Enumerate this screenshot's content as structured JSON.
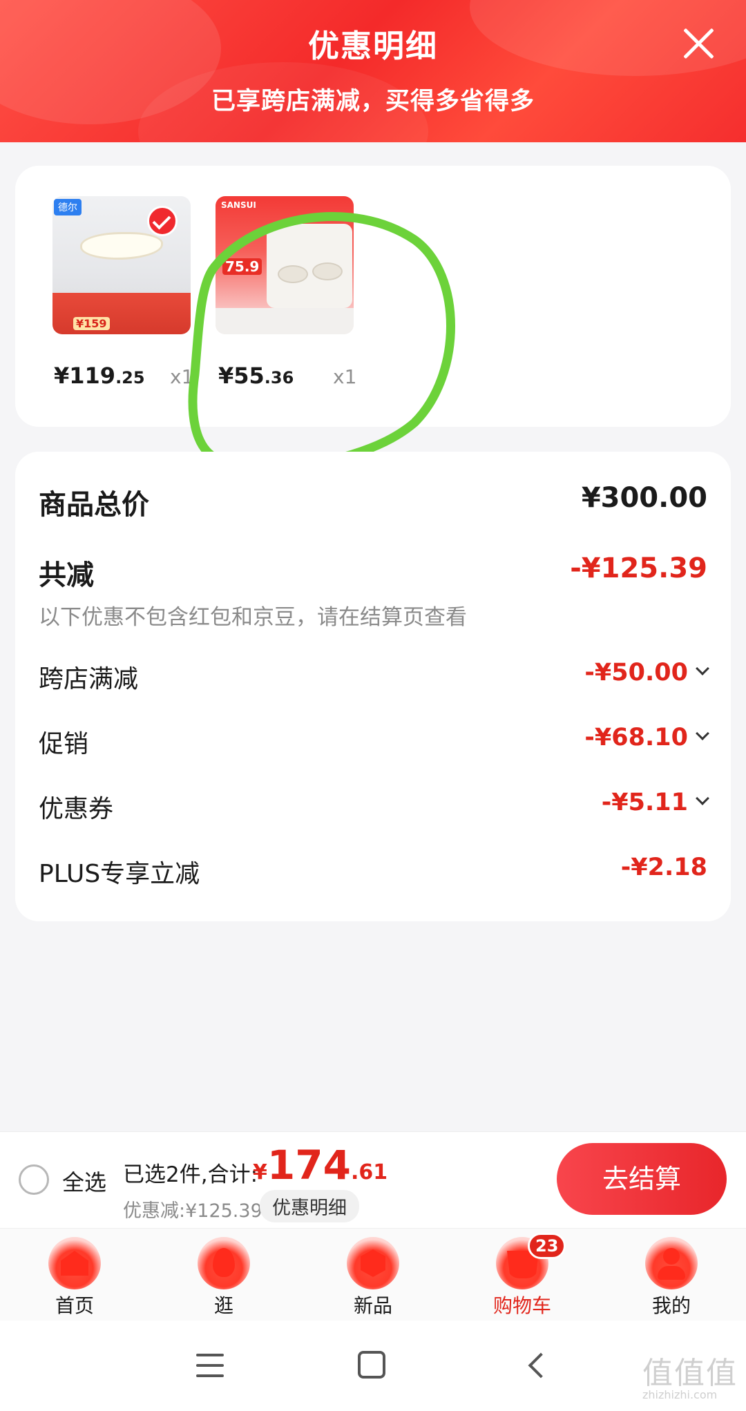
{
  "header": {
    "title": "优惠明细",
    "subtitle": "已享跨店满减，买得多省得多"
  },
  "products": [
    {
      "price_int": "¥119",
      "price_dec": ".25",
      "qty": "x1",
      "image_badge": "德尔",
      "image_price": "¥159"
    },
    {
      "price_int": "¥55",
      "price_dec": ".36",
      "qty": "x1",
      "image_brand": "SANSUI",
      "image_price": "75.9"
    }
  ],
  "summary": {
    "total_label": "商品总价",
    "total_value": "¥300.00",
    "reduce_label": "共减",
    "reduce_value": "-¥125.39",
    "reduce_note": "以下优惠不包含红包和京豆，请在结算页查看",
    "items": [
      {
        "label": "跨店满减",
        "value": "-¥50.00"
      },
      {
        "label": "促销",
        "value": "-¥68.10"
      },
      {
        "label": "优惠券",
        "value": "-¥5.11"
      },
      {
        "label": "PLUS专享立减",
        "value": "-¥2.18"
      }
    ]
  },
  "bottom": {
    "select_all": "全选",
    "selected": "已选2件,合计:",
    "total_currency": "¥",
    "total_int": "174",
    "total_dec": ".61",
    "discount": "优惠减:¥125.39",
    "detail_button": "优惠明细",
    "checkout": "去结算"
  },
  "tabs": [
    {
      "label": "首页",
      "icon": "home-icon"
    },
    {
      "label": "逛",
      "icon": "flame-icon"
    },
    {
      "label": "新品",
      "icon": "cube-icon"
    },
    {
      "label": "购物车",
      "icon": "cart-icon",
      "badge": "23",
      "active": true
    },
    {
      "label": "我的",
      "icon": "person-icon"
    }
  ],
  "watermark": {
    "text": "值值值",
    "url": "zhizhizhi.com"
  },
  "colors": {
    "accent_red": "#e1251b",
    "header_red": "#f42a2a",
    "annotation_green": "#6cd23a"
  }
}
